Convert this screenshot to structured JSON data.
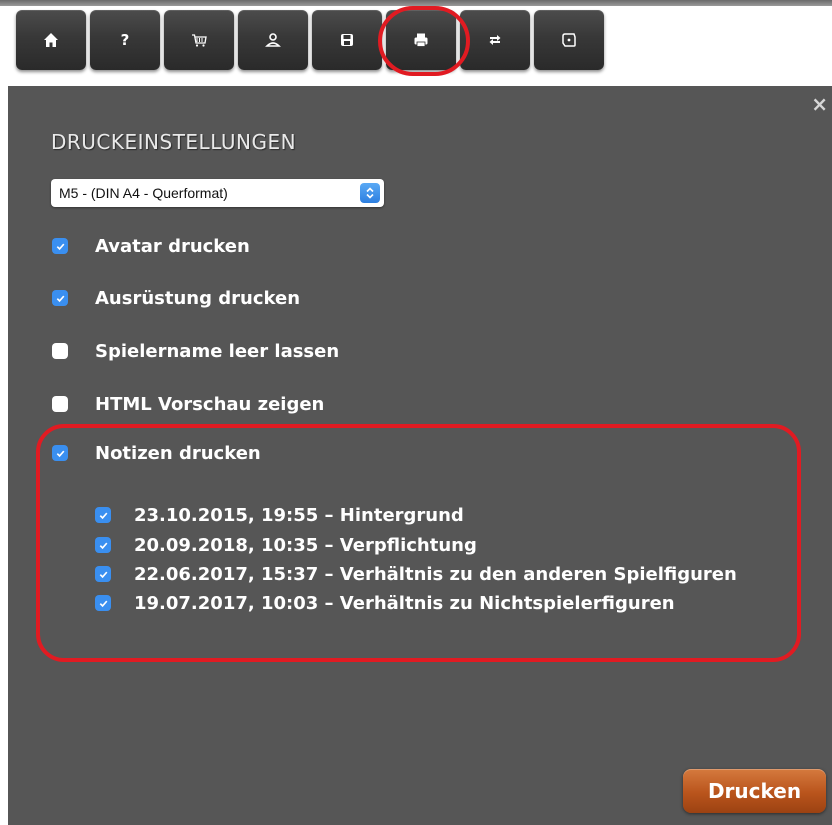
{
  "toolbar": {
    "buttons": [
      {
        "icon": "home-icon"
      },
      {
        "icon": "help-icon",
        "label": "?"
      },
      {
        "icon": "cart-icon"
      },
      {
        "icon": "user-icon"
      },
      {
        "icon": "save-icon"
      },
      {
        "icon": "print-icon"
      },
      {
        "icon": "swap-icon"
      },
      {
        "icon": "dice-icon"
      }
    ],
    "highlighted": "print-icon"
  },
  "dialog": {
    "title": "DRUCKEINSTELLUNGEN",
    "close_label": "×",
    "format_select": {
      "value": "M5 - (DIN A4 - Querformat)"
    },
    "options": [
      {
        "label": "Avatar drucken",
        "checked": true
      },
      {
        "label": "Ausrüstung drucken",
        "checked": true
      },
      {
        "label": "Spielername leer lassen",
        "checked": false
      },
      {
        "label": "HTML Vorschau zeigen",
        "checked": false
      },
      {
        "label": "Notizen drucken",
        "checked": true
      }
    ],
    "notes": [
      {
        "label": "23.10.2015, 19:55 – Hintergrund",
        "checked": true
      },
      {
        "label": "20.09.2018, 10:35 – Verpflichtung",
        "checked": true
      },
      {
        "label": "22.06.2017, 15:37 – Verhältnis zu den anderen Spielfiguren",
        "checked": true
      },
      {
        "label": "19.07.2017, 10:03 – Verhältnis zu Nichtspielerfiguren",
        "checked": true
      }
    ],
    "print_button_label": "Drucken"
  },
  "colors": {
    "panel_bg": "#565656",
    "checkbox_checked": "#3a8ff0",
    "print_button": "#b9541c",
    "annotation_red": "#e11b22"
  }
}
